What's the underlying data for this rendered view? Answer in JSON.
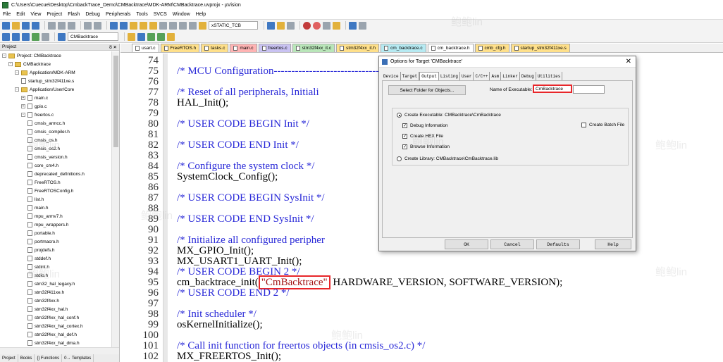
{
  "window": {
    "title": "C:\\Users\\Cuecue\\Desktop\\CmbackTrace_Demo\\CMBacktrace\\MDK-ARM\\CMBacktrace.uvprojx - µVision"
  },
  "menu": [
    "File",
    "Edit",
    "View",
    "Project",
    "Flash",
    "Debug",
    "Peripherals",
    "Tools",
    "SVCS",
    "Window",
    "Help"
  ],
  "toolbar": {
    "find_combo": "xSTATIC_TCB",
    "target_combo": "CMBacktrace"
  },
  "project_pane": {
    "title": "Project",
    "pin": "ȣ ✕",
    "tree": [
      {
        "label": "Project: CMBacktrace",
        "kind": "project",
        "indent": 0,
        "exp": "-"
      },
      {
        "label": "CMBacktrace",
        "kind": "folder",
        "indent": 1,
        "exp": "-"
      },
      {
        "label": "Application/MDK-ARM",
        "kind": "folder",
        "indent": 2,
        "exp": "-"
      },
      {
        "label": "startup_stm32f411xe.s",
        "kind": "file",
        "indent": 3,
        "exp": ""
      },
      {
        "label": "Application/User/Core",
        "kind": "folder",
        "indent": 2,
        "exp": "-"
      },
      {
        "label": "main.c",
        "kind": "file",
        "indent": 3,
        "exp": "+"
      },
      {
        "label": "gpio.c",
        "kind": "file",
        "indent": 3,
        "exp": "+"
      },
      {
        "label": "freertos.c",
        "kind": "file",
        "indent": 3,
        "exp": "-"
      },
      {
        "label": "cmsis_armcc.h",
        "kind": "file",
        "indent": 4,
        "exp": ""
      },
      {
        "label": "cmsis_compiler.h",
        "kind": "file",
        "indent": 4,
        "exp": ""
      },
      {
        "label": "cmsis_os.h",
        "kind": "file",
        "indent": 4,
        "exp": ""
      },
      {
        "label": "cmsis_os2.h",
        "kind": "file",
        "indent": 4,
        "exp": ""
      },
      {
        "label": "cmsis_version.h",
        "kind": "file",
        "indent": 4,
        "exp": ""
      },
      {
        "label": "core_cm4.h",
        "kind": "file",
        "indent": 4,
        "exp": ""
      },
      {
        "label": "deprecated_definitions.h",
        "kind": "file",
        "indent": 4,
        "exp": ""
      },
      {
        "label": "FreeRTOS.h",
        "kind": "file",
        "indent": 4,
        "exp": ""
      },
      {
        "label": "FreeRTOSConfig.h",
        "kind": "file",
        "indent": 4,
        "exp": ""
      },
      {
        "label": "list.h",
        "kind": "file",
        "indent": 4,
        "exp": ""
      },
      {
        "label": "main.h",
        "kind": "file",
        "indent": 4,
        "exp": ""
      },
      {
        "label": "mpu_armv7.h",
        "kind": "file",
        "indent": 4,
        "exp": ""
      },
      {
        "label": "mpu_wrappers.h",
        "kind": "file",
        "indent": 4,
        "exp": ""
      },
      {
        "label": "portable.h",
        "kind": "file",
        "indent": 4,
        "exp": ""
      },
      {
        "label": "portmacro.h",
        "kind": "file",
        "indent": 4,
        "exp": ""
      },
      {
        "label": "projdefs.h",
        "kind": "file",
        "indent": 4,
        "exp": ""
      },
      {
        "label": "stddef.h",
        "kind": "file",
        "indent": 4,
        "exp": ""
      },
      {
        "label": "stdint.h",
        "kind": "file",
        "indent": 4,
        "exp": ""
      },
      {
        "label": "stdio.h",
        "kind": "file",
        "indent": 4,
        "exp": ""
      },
      {
        "label": "stm32_hal_legacy.h",
        "kind": "file",
        "indent": 4,
        "exp": ""
      },
      {
        "label": "stm32f411xe.h",
        "kind": "file",
        "indent": 4,
        "exp": ""
      },
      {
        "label": "stm32f4xx.h",
        "kind": "file",
        "indent": 4,
        "exp": ""
      },
      {
        "label": "stm32f4xx_hal.h",
        "kind": "file",
        "indent": 4,
        "exp": ""
      },
      {
        "label": "stm32f4xx_hal_conf.h",
        "kind": "file",
        "indent": 4,
        "exp": ""
      },
      {
        "label": "stm32f4xx_hal_cortex.h",
        "kind": "file",
        "indent": 4,
        "exp": ""
      },
      {
        "label": "stm32f4xx_hal_def.h",
        "kind": "file",
        "indent": 4,
        "exp": ""
      },
      {
        "label": "stm32f4xx_hal_dma.h",
        "kind": "file",
        "indent": 4,
        "exp": ""
      }
    ],
    "bottom_tabs": [
      "Project",
      "Books",
      "{} Functions",
      "0→ Templates"
    ]
  },
  "file_tabs": [
    {
      "label": "usart.c",
      "color": "#ffffff"
    },
    {
      "label": "FreeRTOS.h",
      "color": "#ffe08a"
    },
    {
      "label": "tasks.c",
      "color": "#ffe08a"
    },
    {
      "label": "main.c",
      "color": "#ffb3b3"
    },
    {
      "label": "freertos.c",
      "color": "#c9c2f2"
    },
    {
      "label": "stm32f4xx_it.c",
      "color": "#b9e6b9"
    },
    {
      "label": "stm32f4xx_it.h",
      "color": "#ffe08a"
    },
    {
      "label": "cm_backtrace.c",
      "color": "#b6eaf2"
    },
    {
      "label": "cm_backtrace.h",
      "color": "#ffffff"
    },
    {
      "label": "cmb_cfg.h",
      "color": "#ffe08a"
    },
    {
      "label": "startup_stm32f411xe.s",
      "color": "#ffe08a"
    }
  ],
  "editor": {
    "lines": [
      {
        "num": "74",
        "text": "",
        "kind": "code"
      },
      {
        "num": "75",
        "text": "/* MCU Configuration--------------------------------",
        "kind": "comment"
      },
      {
        "num": "76",
        "text": "",
        "kind": "code"
      },
      {
        "num": "77",
        "text": "/* Reset of all peripherals, Initiali",
        "kind": "comment"
      },
      {
        "num": "78",
        "text": "HAL_Init();",
        "kind": "code"
      },
      {
        "num": "79",
        "text": "",
        "kind": "code"
      },
      {
        "num": "80",
        "text": "/* USER CODE BEGIN Init */",
        "kind": "comment"
      },
      {
        "num": "81",
        "text": "",
        "kind": "code"
      },
      {
        "num": "82",
        "text": "/* USER CODE END Init */",
        "kind": "comment"
      },
      {
        "num": "83",
        "text": "",
        "kind": "code"
      },
      {
        "num": "84",
        "text": "/* Configure the system clock */",
        "kind": "comment"
      },
      {
        "num": "85",
        "text": "SystemClock_Config();",
        "kind": "code"
      },
      {
        "num": "86",
        "text": "",
        "kind": "code"
      },
      {
        "num": "87",
        "text": "/* USER CODE BEGIN SysInit */",
        "kind": "comment"
      },
      {
        "num": "88",
        "text": "",
        "kind": "code"
      },
      {
        "num": "89",
        "text": "/* USER CODE END SysInit */",
        "kind": "comment"
      },
      {
        "num": "90",
        "text": "",
        "kind": "code"
      },
      {
        "num": "91",
        "text": "/* Initialize all configured peripher",
        "kind": "comment"
      },
      {
        "num": "92",
        "text": "MX_GPIO_Init();",
        "kind": "code"
      },
      {
        "num": "93",
        "text": "MX_USART1_UART_Init();",
        "kind": "code"
      },
      {
        "num": "94",
        "text": "/* USER CODE BEGIN 2 */",
        "kind": "comment"
      },
      {
        "num": "95",
        "text": "",
        "kind": "special"
      },
      {
        "num": "96",
        "text": "/* USER CODE END 2 */",
        "kind": "comment"
      },
      {
        "num": "97",
        "text": "",
        "kind": "code"
      },
      {
        "num": "98",
        "text": "/* Init scheduler */",
        "kind": "comment"
      },
      {
        "num": "99",
        "text": "osKernelInitialize();",
        "kind": "code"
      },
      {
        "num": "100",
        "text": "",
        "kind": "code"
      },
      {
        "num": "101",
        "text": "/* Call init function for freertos objects (in cmsis_os2.c) */",
        "kind": "comment"
      },
      {
        "num": "102",
        "text": "MX_FREERTOS_Init();",
        "kind": "code"
      }
    ],
    "special_line": {
      "prefix": "cm_backtrace_init(",
      "string": "\"CmBacktrace\"",
      "suffix": " HARDWARE_VERSION, SOFTWARE_VERSION);"
    }
  },
  "dialog": {
    "title": "Options for Target 'CMBacktrace'",
    "close": "✕",
    "tabs": [
      "Device",
      "Target",
      "Output",
      "Listing",
      "User",
      "C/C++",
      "Asm",
      "Linker",
      "Debug",
      "Utilities"
    ],
    "active_tab": "Output",
    "select_folder": "Select Folder for Objects...",
    "name_label": "Name of Executable:",
    "name_value": "CmBacktrace",
    "create_exe": "Create Executable:  CMBacktrace\\CmBacktrace",
    "debug_info": "Debug Information",
    "create_hex": "Create HEX File",
    "browse_info": "Browse Information",
    "create_batch": "Create Batch File",
    "create_lib": "Create Library:  CMBacktrace\\CmBacktrace.lib",
    "ok": "OK",
    "cancel": "Cancel",
    "defaults": "Defaults",
    "help": "Help"
  },
  "watermark": "鲍鲍lin",
  "colors": {
    "comment": "#2a2ad8",
    "string": "#a31515",
    "highlight": "#e8262a"
  }
}
